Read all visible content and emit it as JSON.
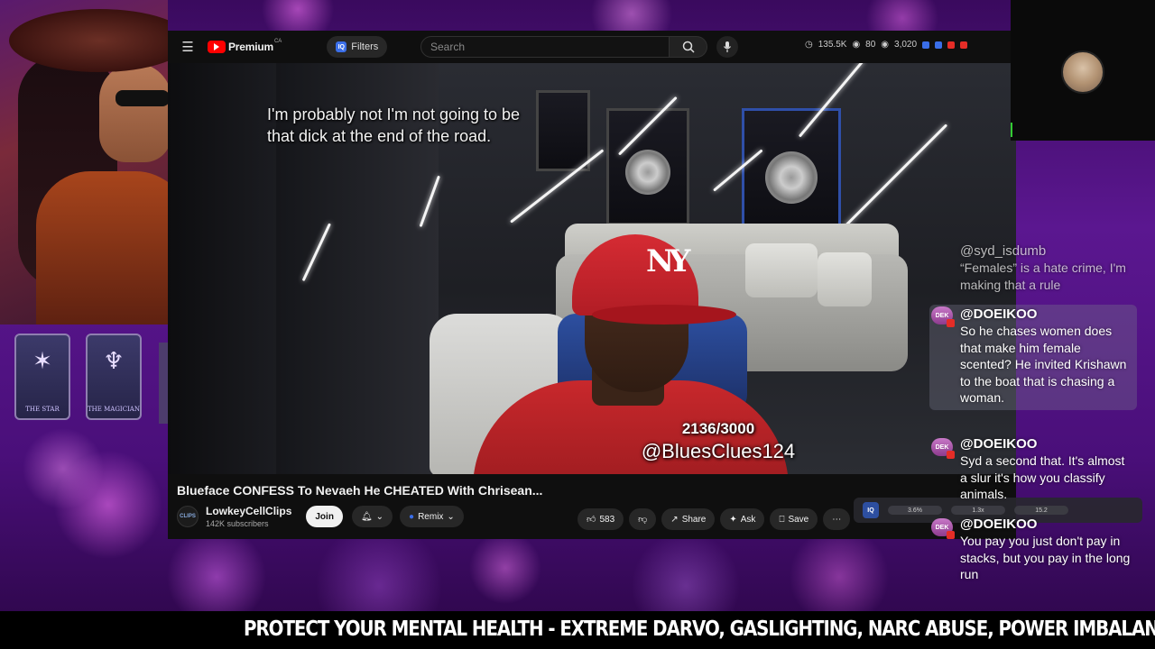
{
  "youtube": {
    "brand": "Premium",
    "region": "CA",
    "filters_label": "Filters",
    "filters_icon_text": "IQ",
    "search_placeholder": "Search",
    "stats": [
      "135.5K",
      "80",
      "3,020"
    ]
  },
  "video": {
    "caption_line1": "I'm probably not I'm not going to be",
    "caption_line2": "that dick at the end of the road.",
    "counter": "2136/3000",
    "counter_handle": "@BluesClues124",
    "title": "Blueface CONFESS To Nevaeh He CHEATED With Chrisean...",
    "channel_name": "LowkeyCellClips",
    "channel_badge": "CLIPS",
    "channel_subs": "142K subscribers",
    "join_label": "Join",
    "remix_label": "Remix",
    "like_count": "583",
    "share_label": "Share",
    "ask_label": "Ask",
    "save_label": "Save"
  },
  "side_panel": {
    "iq_label": "IQ",
    "values": [
      "3.6%",
      "1.3x",
      "15.2"
    ]
  },
  "tarot": [
    {
      "name": "THE STAR"
    },
    {
      "name": "THE MAGICIAN"
    }
  ],
  "chat": [
    {
      "user": "@syd_isdumb",
      "text": "“Females” is a hate crime, I'm making that a rule",
      "badge": ""
    },
    {
      "user": "@DOEIKOO",
      "text": "So he chases women does that make him female scented? He invited Krishawn to the boat that is chasing a woman.",
      "badge": "DEK"
    },
    {
      "user": "@DOEIKOO",
      "text": "Syd a second that. It's almost a slur it's how you classify animals.",
      "badge": "DEK"
    },
    {
      "user": "@DOEIKOO",
      "text": "You pay you just don't pay in stacks, but you pay in the long run",
      "badge": "DEK"
    }
  ],
  "ticker": "PROTECT YOUR MENTAL HEALTH - EXTREME DARVO, GASLIGHTING, NARC ABUSE, POWER IMBALAN",
  "colors": {
    "youtube_red": "#ff0000",
    "background_purple": "#5b1790",
    "chat_badge": "#c879c8"
  }
}
